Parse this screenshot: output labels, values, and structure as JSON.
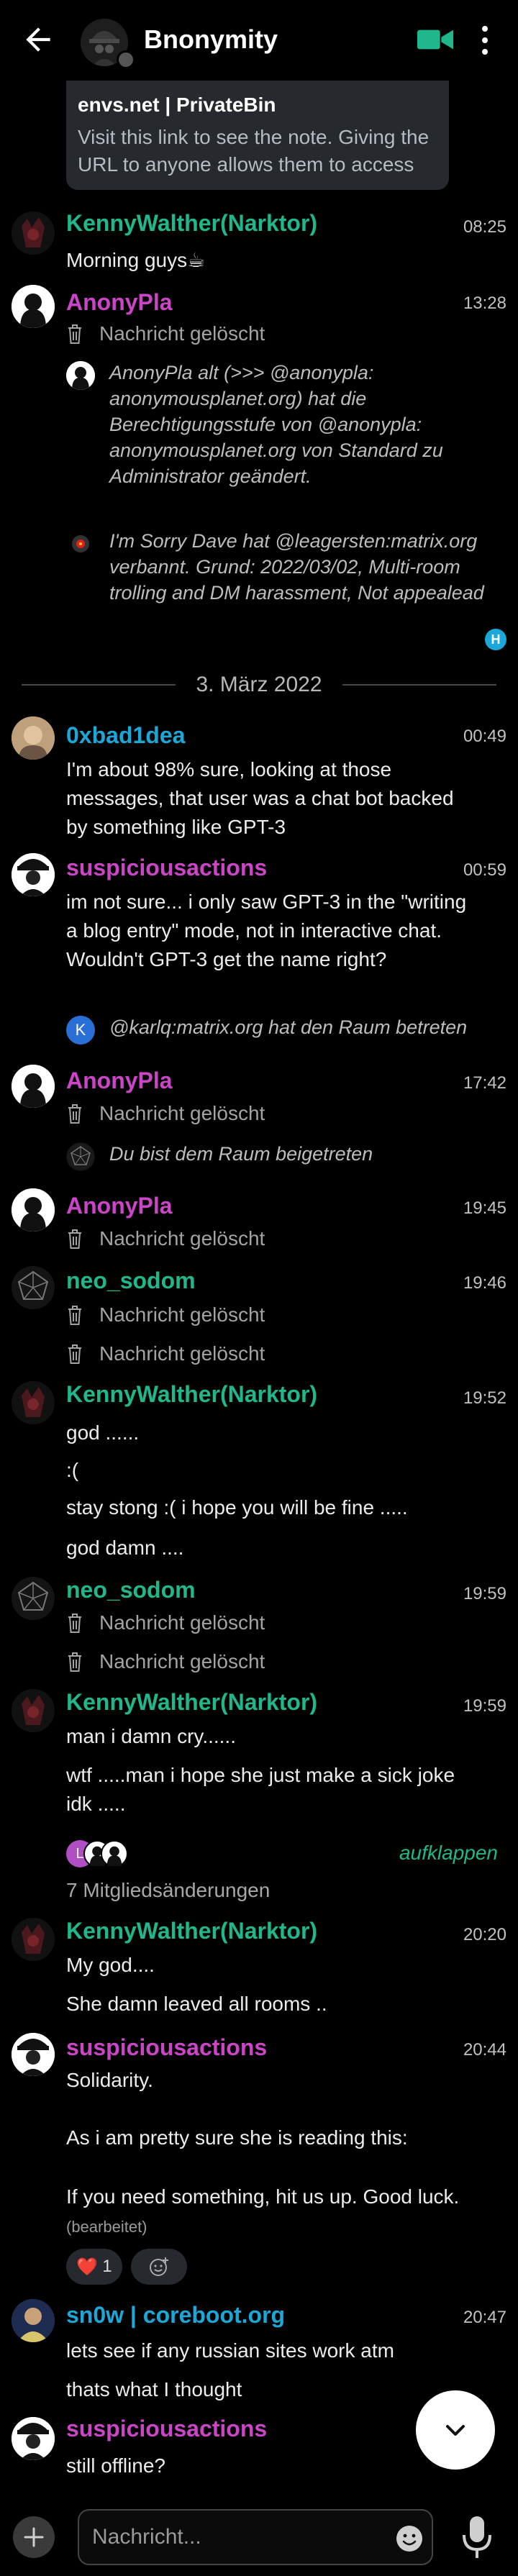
{
  "header": {
    "title": "Bnonymity",
    "accent_color": "#1fb78b"
  },
  "link_preview": {
    "title": "envs.net | PrivateBin",
    "description": "Visit this link to see the note. Giving the URL to anyone allows them to access t..."
  },
  "messages": {
    "m1": {
      "sender": "KennyWalther(Narktor)",
      "time": "08:25",
      "text": "Morning guys☕"
    },
    "m2": {
      "sender": "AnonyPla",
      "time": "13:28",
      "deleted": "Nachricht gelöscht",
      "notice1": "AnonyPla alt (>>> @anonypla: anonymousplanet.org) hat die Berechtigungsstufe von @anonypla: anonymousplanet.org von Standard zu Administrator geändert.",
      "notice2": "I'm Sorry Dave hat @leagersten:matrix.org verbannt. Grund: 2022/03/02, Multi-room trolling and DM harassment, Not appealead",
      "seen_initial": "H"
    },
    "date_separator": "3. März 2022",
    "m3": {
      "sender": "0xbad1dea",
      "time": "00:49",
      "text": "I'm about 98% sure, looking at those messages, that user was a chat bot backed by something like GPT-3"
    },
    "m4": {
      "sender": "suspiciousactions",
      "time": "00:59",
      "text": "im not sure... i only saw GPT-3 in the \"writing a blog entry\" mode, not in interactive chat. Wouldn't GPT-3 get the name right?",
      "notice": "@karlq:matrix.org hat den Raum betreten",
      "notice_initial": "K"
    },
    "m5": {
      "sender": "AnonyPla",
      "time": "17:42",
      "deleted": "Nachricht gelöscht",
      "notice": "Du bist dem Raum beigetreten"
    },
    "m6": {
      "sender": "AnonyPla",
      "time": "19:45",
      "deleted": "Nachricht gelöscht"
    },
    "m7": {
      "sender": "neo_sodom",
      "time": "19:46",
      "deleted1": "Nachricht gelöscht",
      "deleted2": "Nachricht gelöscht"
    },
    "m8": {
      "sender": "KennyWalther(Narktor)",
      "time": "19:52",
      "line1": "god ......",
      "line2": ":(",
      "line3": "stay stong :( i hope you will be fine .....",
      "line4": "god damn ...."
    },
    "m9": {
      "sender": "neo_sodom",
      "time": "19:59",
      "deleted1": "Nachricht gelöscht",
      "deleted2": "Nachricht gelöscht"
    },
    "m10": {
      "sender": "KennyWalther(Narktor)",
      "time": "19:59",
      "line1": "man i damn cry......",
      "line2": "wtf .....man i hope she just make a sick joke idk ....."
    },
    "membership": {
      "expand_label": "aufklappen",
      "count_label": "7 Mitgliedsänderungen",
      "initial": "L"
    },
    "m11": {
      "sender": "KennyWalther(Narktor)",
      "time": "20:20",
      "line1": "My god....",
      "line2": "She damn leaved all rooms .."
    },
    "m12": {
      "sender": "suspiciousactions",
      "time": "20:44",
      "line1": "Solidarity.",
      "line2": "As i am pretty sure she is reading this:",
      "line3": "If you need something, hit us up. Good luck.",
      "edited": "(bearbeitet)",
      "reaction_emoji": "❤️",
      "reaction_count": "1"
    },
    "m13": {
      "sender": "sn0w | coreboot.org",
      "time": "20:47",
      "line1": "lets see if any russian sites work atm",
      "line2": "thats what I thought"
    },
    "m14": {
      "sender": "suspiciousactions",
      "line1": "still offline?"
    }
  },
  "composer": {
    "placeholder": "Nachricht..."
  }
}
